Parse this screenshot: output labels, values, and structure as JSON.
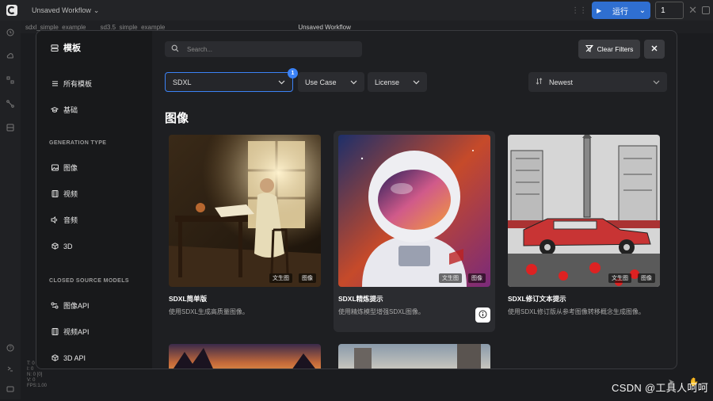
{
  "topbar": {
    "workflow_title": "Unsaved Workflow",
    "run_label": "运行",
    "run_count": "1"
  },
  "tabstrip": {
    "tabs": [
      "sdxl_simple_example",
      "sd3.5_simple_example",
      "Unsaved Workflow"
    ]
  },
  "stats": [
    "T: 0",
    "I: 0",
    "N: 0 [0]",
    "V: 0",
    "FPS:1.00"
  ],
  "sidebar": {
    "title": "模板",
    "items": [
      "所有模板",
      "基础"
    ],
    "section_generation": "GENERATION TYPE",
    "generation_items": [
      "图像",
      "视频",
      "音频",
      "3D"
    ],
    "section_closed": "CLOSED SOURCE MODELS",
    "closed_items": [
      "图像API",
      "视频API",
      "3D API"
    ]
  },
  "search": {
    "placeholder": "Search..."
  },
  "toolbar": {
    "clear_filters": "Clear Filters"
  },
  "filters": {
    "model": "SDXL",
    "model_badge": "1",
    "use_case": "Use Case",
    "license": "License",
    "sort": "Newest"
  },
  "section_title": "图像",
  "cards": [
    {
      "title": "SDXL简单版",
      "desc": "使用SDXL生成高质量图像。",
      "tags": [
        "文生图",
        "图像"
      ]
    },
    {
      "title": "SDXL精炼提示",
      "desc": "使用精炼模型增强SDXL图像。",
      "tags": [
        "文生图",
        "图像"
      ]
    },
    {
      "title": "SDXL修订文本提示",
      "desc": "使用SDXL修订版从参考图像转移概念生成图像。",
      "tags": [
        "文生图",
        "图像"
      ]
    }
  ],
  "watermark": "CSDN @工具人呵呵",
  "colors": {
    "accent": "#3b82f6",
    "run": "#2f6fd1"
  }
}
